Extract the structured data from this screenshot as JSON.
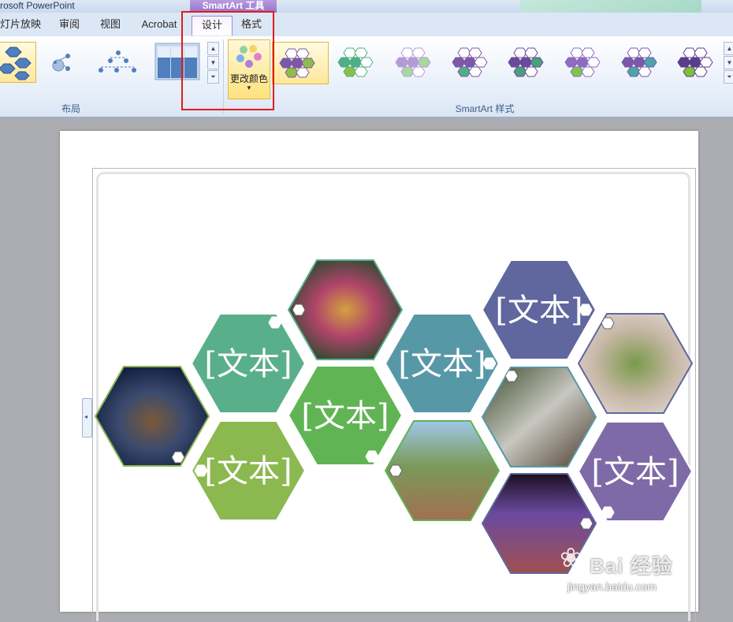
{
  "app": {
    "title": "rosoft PowerPoint",
    "context_tab_group": "SmartArt 工具"
  },
  "tabs": [
    {
      "label": "灯片放映"
    },
    {
      "label": "审阅"
    },
    {
      "label": "视图"
    },
    {
      "label": "Acrobat"
    },
    {
      "label": "设计"
    },
    {
      "label": "格式"
    }
  ],
  "ribbon": {
    "layout_group_label": "布局",
    "recolor_label": "更改颜色",
    "styles_group_label": "SmartArt 样式",
    "layout_scroll": [
      "▲",
      "▼",
      "⏷"
    ],
    "styles_scroll": [
      "▲",
      "▼",
      "⏷"
    ]
  },
  "diagram": {
    "placeholder": "[文本]",
    "colors": {
      "teal": "#5aaf8b",
      "green": "#60b454",
      "olive": "#8cb850",
      "slate": "#5798a6",
      "indigo": "#60679f",
      "violet": "#7e6aa6"
    }
  },
  "watermark": {
    "brand": "Bai  经验",
    "url": "jingyan.baidu.com",
    "icon": "bear-paw-icon"
  }
}
